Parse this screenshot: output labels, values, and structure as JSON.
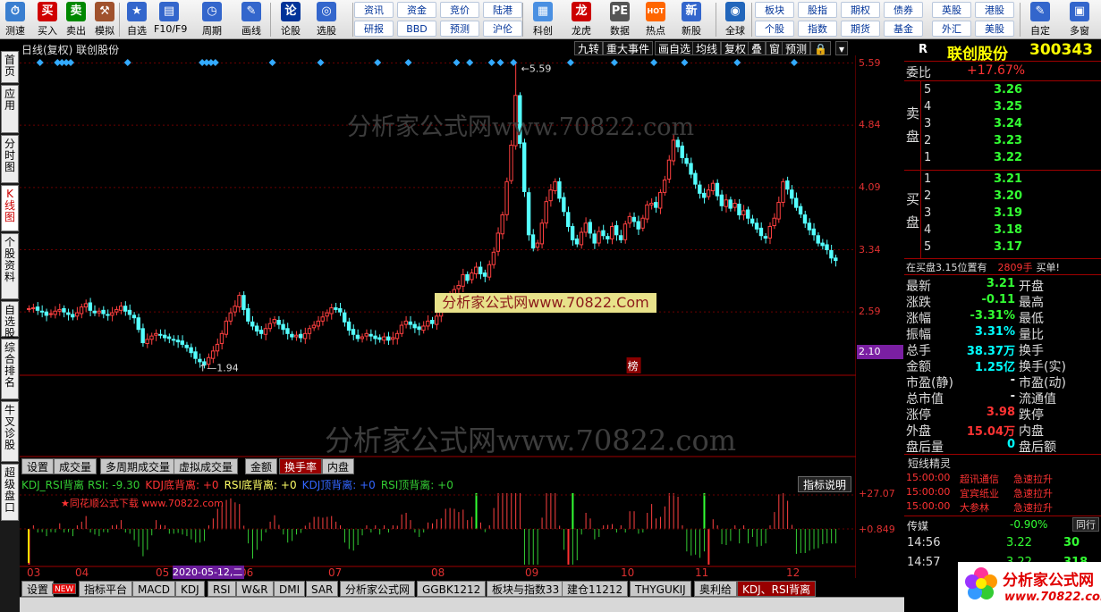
{
  "toolbar": {
    "big": [
      {
        "label": "测速",
        "icon": "speed-icon",
        "color": "#3a7fd0"
      },
      {
        "label": "买入",
        "icon": "buy-icon",
        "color": "#d00000",
        "glyph": "买"
      },
      {
        "label": "卖出",
        "icon": "sell-icon",
        "color": "#008800",
        "glyph": "卖"
      },
      {
        "label": "模拟",
        "icon": "hammer-icon",
        "color": "#a0522d",
        "glyph": "⚒"
      },
      {
        "label": "自选",
        "icon": "star-icon",
        "color": "#3366cc",
        "glyph": "★"
      },
      {
        "label": "F10/F9",
        "icon": "f10-icon",
        "color": "#3366cc",
        "glyph": "▤"
      },
      {
        "label": "周期",
        "icon": "clock-icon",
        "color": "#3366cc",
        "glyph": "◷"
      },
      {
        "label": "画线",
        "icon": "pen-icon",
        "color": "#3366cc",
        "glyph": "✎"
      },
      {
        "label": "论股",
        "icon": "discuss-icon",
        "color": "#003399",
        "glyph": "论"
      },
      {
        "label": "选股",
        "icon": "select-icon",
        "color": "#3366cc",
        "glyph": "◎"
      },
      {
        "label": "科创",
        "icon": "kechuang-icon",
        "color": "#4a90e2",
        "glyph": "▦"
      },
      {
        "label": "龙虎",
        "icon": "dragon-icon",
        "color": "#cc0000",
        "glyph": "龙"
      },
      {
        "label": "数据",
        "icon": "pe-icon",
        "color": "#555555",
        "glyph": "PE"
      },
      {
        "label": "热点",
        "icon": "hot-icon",
        "color": "#ff6600",
        "glyph": "HOT"
      },
      {
        "label": "新股",
        "icon": "newstock-icon",
        "color": "#3366cc",
        "glyph": "新"
      },
      {
        "label": "全球",
        "icon": "globe-icon",
        "color": "#2266bb",
        "glyph": "◉"
      },
      {
        "label": "自定",
        "icon": "custom-icon",
        "color": "#3366cc",
        "glyph": "✎"
      },
      {
        "label": "多窗",
        "icon": "multiwindow-icon",
        "color": "#3366cc",
        "glyph": "▣"
      }
    ],
    "small_top": [
      "资讯",
      "资金",
      "竞价",
      "陆港",
      "板块",
      "股指",
      "期权",
      "债券",
      "英股",
      "港股"
    ],
    "small_bottom": [
      "研报",
      "BBD",
      "预测",
      "沪伦",
      "个股",
      "指数",
      "期货",
      "基金",
      "外汇",
      "美股"
    ]
  },
  "side_tabs": [
    {
      "label": "首页",
      "active": false
    },
    {
      "label": "应用",
      "active": false
    },
    {
      "label": "分时图",
      "active": false
    },
    {
      "label": "K线图",
      "active": true
    },
    {
      "label": "个股资料",
      "active": false
    },
    {
      "label": "自选股",
      "active": false
    },
    {
      "label": "综合排名",
      "active": false
    },
    {
      "label": "牛叉诊股",
      "active": false
    },
    {
      "label": "超级盘口",
      "active": false
    }
  ],
  "chart_header": {
    "title": "日线(复权) 联创股份",
    "buttons": [
      "九转",
      "重大事件",
      "画自选",
      "均线",
      "复权",
      "叠",
      "窗",
      "预测",
      "🔒"
    ]
  },
  "watermarks": {
    "big1": "分析家公式网www.70822.com",
    "big2": "分析家公式网www.70822.com",
    "banner": "分析家公式网www.70822.Com",
    "small": "★同花顺公式下载 www.70822.com",
    "badge_title": "分析家公式网",
    "badge_url": "www.70822.com"
  },
  "price_axis": {
    "labels": [
      "5.59",
      "4.84",
      "4.09",
      "3.34",
      "2.59"
    ],
    "current": "2.10",
    "current_color": "#7a1fa2"
  },
  "chart_annotations": {
    "high": "5.59",
    "low": "1.94",
    "bang": "榜"
  },
  "chart_data": {
    "type": "candlestick",
    "title": "日线(复权) 联创股份",
    "ylim": [
      1.86,
      5.66
    ],
    "high": 5.59,
    "low": 1.94,
    "x_tick_labels": [
      "03",
      "04",
      "05",
      "06",
      "07",
      "08",
      "09",
      "10",
      "11",
      "12"
    ],
    "closes": [
      2.63,
      2.64,
      2.61,
      2.59,
      2.55,
      2.57,
      2.6,
      2.62,
      2.59,
      2.56,
      2.53,
      2.58,
      2.65,
      2.69,
      2.61,
      2.58,
      2.6,
      2.57,
      2.55,
      2.58,
      2.62,
      2.66,
      2.6,
      2.56,
      2.52,
      2.38,
      2.22,
      2.26,
      2.3,
      2.33,
      2.31,
      2.28,
      2.27,
      2.25,
      2.23,
      2.2,
      2.16,
      2.1,
      2.03,
      1.99,
      1.95,
      2.04,
      2.12,
      2.2,
      2.33,
      2.48,
      2.58,
      2.66,
      2.79,
      2.62,
      2.48,
      2.42,
      2.36,
      2.33,
      2.39,
      2.45,
      2.5,
      2.44,
      2.38,
      2.33,
      2.29,
      2.31,
      2.28,
      2.33,
      2.39,
      2.43,
      2.48,
      2.53,
      2.58,
      2.64,
      2.62,
      2.59,
      2.47,
      2.37,
      2.32,
      2.27,
      2.29,
      2.33,
      2.3,
      2.27,
      2.26,
      2.29,
      2.25,
      2.28,
      2.33,
      2.43,
      2.48,
      2.44,
      2.4,
      2.38,
      2.42,
      2.48,
      2.45,
      2.54,
      2.61,
      2.7,
      2.8,
      2.86,
      2.91,
      3.04,
      2.97,
      3.06,
      3.13,
      3.05,
      3.02,
      3.16,
      3.31,
      3.54,
      3.76,
      4.16,
      4.6,
      5.2,
      4.62,
      4.04,
      3.52,
      3.36,
      3.42,
      3.66,
      3.92,
      4.06,
      4.16,
      3.96,
      3.8,
      3.62,
      3.46,
      3.41,
      3.55,
      3.66,
      3.54,
      3.42,
      3.56,
      3.51,
      3.47,
      3.62,
      3.52,
      3.46,
      3.65,
      3.74,
      3.68,
      3.59,
      3.72,
      3.88,
      3.9,
      3.85,
      4.03,
      4.18,
      4.42,
      4.66,
      4.58,
      4.45,
      4.38,
      4.25,
      4.13,
      4.02,
      3.97,
      4.06,
      4.14,
      3.99,
      3.87,
      3.94,
      3.84,
      3.9,
      3.76,
      3.81,
      3.72,
      3.66,
      3.59,
      3.51,
      3.48,
      3.62,
      3.72,
      3.91,
      4.16,
      4.07,
      3.96,
      3.85,
      3.77,
      3.66,
      3.58,
      3.52,
      3.42,
      3.39,
      3.34,
      3.24,
      3.21
    ]
  },
  "tabs_mid": [
    "设置",
    "成交量",
    "多周期成交量",
    "虚拟成交量",
    "金额",
    "换手率",
    "内盘"
  ],
  "tabs_mid_selected": 5,
  "indicator_legend": [
    {
      "text": "KDJ_RSI背离 RSI: -9.30",
      "color": "#33cc33"
    },
    {
      "text": "KDJ底背离: +0",
      "color": "#ff3333"
    },
    {
      "text": "RSI底背离: +0",
      "color": "#ffff66"
    },
    {
      "text": "KDJ顶背离: +0",
      "color": "#3366ff"
    },
    {
      "text": "RSI顶背离: +0",
      "color": "#33cc33"
    }
  ],
  "indicator_help": "指标说明",
  "indicator_axis": {
    "top": "+27.07",
    "mid": "+0.849"
  },
  "date_highlight": "2020-05-12,二",
  "tabs_bottom": [
    "设置",
    "NEW",
    "指标平台",
    "MACD",
    "KDJ",
    "RSI",
    "W&R",
    "DMI",
    "SAR",
    "分析家公式网",
    "GGBK1212",
    "板块与指数33",
    "建仓11212",
    "THYGUKIJ",
    "奥利给",
    "KDJ、RSI背离"
  ],
  "tabs_bottom_selected": 15,
  "stock": {
    "code": "300343",
    "name": "联创股份",
    "flag": "R",
    "weibi_label": "委比",
    "weibi": "+17.67%",
    "sell_label": "卖盘",
    "buy_label": "买盘",
    "sell": [
      {
        "level": "5",
        "price": "3.26"
      },
      {
        "level": "4",
        "price": "3.25"
      },
      {
        "level": "3",
        "price": "3.24"
      },
      {
        "level": "2",
        "price": "3.23"
      },
      {
        "level": "1",
        "price": "3.22"
      }
    ],
    "buy": [
      {
        "level": "1",
        "price": "3.21"
      },
      {
        "level": "2",
        "price": "3.20"
      },
      {
        "level": "3",
        "price": "3.19"
      },
      {
        "level": "4",
        "price": "3.18"
      },
      {
        "level": "5",
        "price": "3.17"
      }
    ],
    "notice_pre": "在买盘3.15位置有",
    "notice_qty": "2809手",
    "notice_post": "买单!",
    "stats": [
      {
        "l1": "最新",
        "v1": "3.21",
        "c1": "grn",
        "l2": "开盘",
        "v2": ""
      },
      {
        "l1": "涨跌",
        "v1": "-0.11",
        "c1": "grn",
        "l2": "最高",
        "v2": ""
      },
      {
        "l1": "涨幅",
        "v1": "-3.31%",
        "c1": "grn",
        "l2": "最低",
        "v2": ""
      },
      {
        "l1": "振幅",
        "v1": "3.31%",
        "c1": "cyan",
        "l2": "量比",
        "v2": ""
      },
      {
        "l1": "总手",
        "v1": "38.37万",
        "c1": "cyan",
        "l2": "换手",
        "v2": ""
      },
      {
        "l1": "金额",
        "v1": "1.25亿",
        "c1": "cyan",
        "l2": "换手(实)",
        "v2": ""
      },
      {
        "l1": "市盈(静)",
        "v1": "-",
        "c1": "wht",
        "l2": "市盈(动)",
        "v2": ""
      },
      {
        "l1": "总市值",
        "v1": "-",
        "c1": "wht",
        "l2": "流通值",
        "v2": ""
      },
      {
        "l1": "涨停",
        "v1": "3.98",
        "c1": "red",
        "l2": "跌停",
        "v2": ""
      },
      {
        "l1": "外盘",
        "v1": "15.04万",
        "c1": "red",
        "l2": "内盘",
        "v2": ""
      },
      {
        "l1": "盘后量",
        "v1": "0",
        "c1": "cyan",
        "l2": "盘后额",
        "v2": ""
      }
    ],
    "sprite_title": "短线精灵",
    "sprite": [
      {
        "time": "15:00:00",
        "name": "超讯通信",
        "action": "急速拉升"
      },
      {
        "time": "15:00:00",
        "name": "宜宾纸业",
        "action": "急速拉升"
      },
      {
        "time": "15:00:00",
        "name": "大参林",
        "action": "急速拉升"
      }
    ],
    "sector_name": "传媒",
    "sector_change": "-0.90%",
    "sector_btn": "同行",
    "ticks": [
      {
        "time": "14:56",
        "price": "3.22",
        "vol": "30"
      },
      {
        "time": "14:57",
        "price": "3.22",
        "vol": "318"
      }
    ]
  }
}
